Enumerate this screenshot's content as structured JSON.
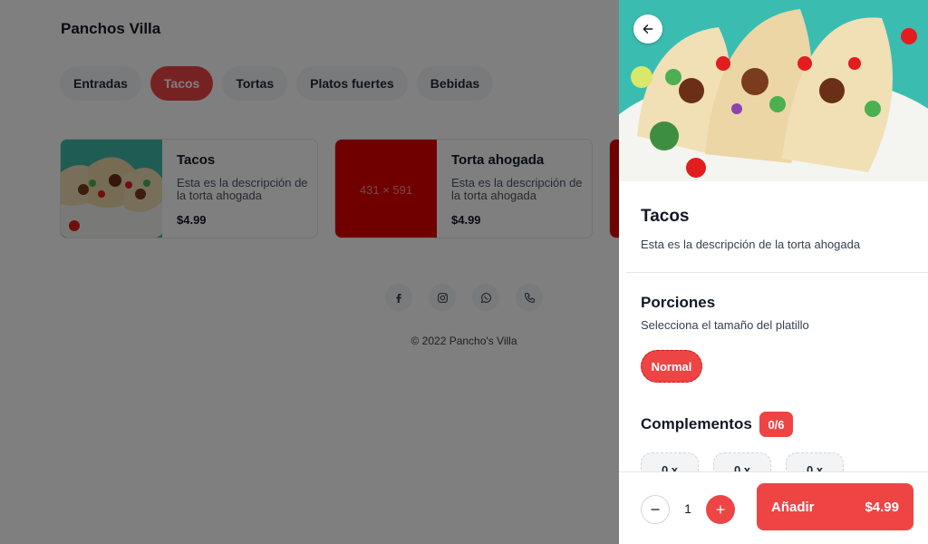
{
  "brand": "Panchos Villa",
  "categories": [
    {
      "label": "Entradas",
      "active": false
    },
    {
      "label": "Tacos",
      "active": true
    },
    {
      "label": "Tortas",
      "active": false
    },
    {
      "label": "Platos fuertes",
      "active": false
    },
    {
      "label": "Bebidas",
      "active": false
    }
  ],
  "products": [
    {
      "title": "Tacos",
      "desc": "Esta es la descripción de la torta ahogada",
      "price": "$4.99",
      "image": "tacos-photo"
    },
    {
      "title": "Torta ahogada",
      "desc": "Esta es la descripción de la torta ahogada",
      "price": "$4.99",
      "image_text": "431 × 591"
    }
  ],
  "socials": [
    "facebook-icon",
    "instagram-icon",
    "whatsapp-icon",
    "phone-icon"
  ],
  "copyright": "© 2022 Pancho's Villa",
  "drawer": {
    "title": "Tacos",
    "description": "Esta es la descripción de la torta ahogada",
    "portions": {
      "title": "Porciones",
      "subtitle": "Selecciona el tamaño del platillo",
      "option": "Normal"
    },
    "complements": {
      "title": "Complementos",
      "badge": "0/6",
      "items": [
        "0 x",
        "0 x",
        "0 x"
      ]
    },
    "quantity": "1",
    "add_label": "Añadir",
    "add_price": "$4.99"
  },
  "colors": {
    "accent": "#ef4444",
    "teal": "#37b7aa"
  }
}
